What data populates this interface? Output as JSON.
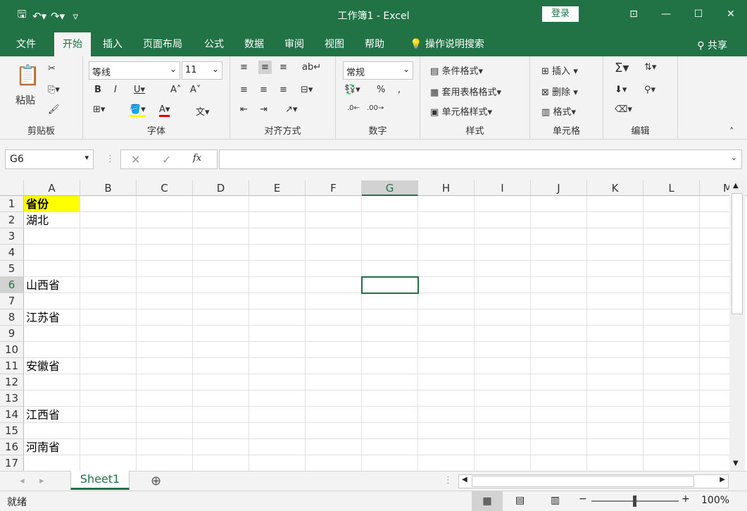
{
  "titlebar": {
    "title": "工作簿1 - Excel",
    "login": "登录",
    "qat": [
      "save-icon",
      "undo-icon",
      "redo-icon",
      "customize-icon"
    ]
  },
  "menu": {
    "tabs": [
      "文件",
      "开始",
      "插入",
      "页面布局",
      "公式",
      "数据",
      "审阅",
      "视图",
      "帮助"
    ],
    "active_tab": "开始",
    "search": "操作说明搜索",
    "share": "共享"
  },
  "ribbon": {
    "clipboard": {
      "label": "剪贴板",
      "paste": "粘贴"
    },
    "font": {
      "label": "字体",
      "font_name": "等线",
      "font_size": "11"
    },
    "align": {
      "label": "对齐方式"
    },
    "number": {
      "label": "数字",
      "format": "常规"
    },
    "styles": {
      "label": "样式",
      "cond": "条件格式",
      "table": "套用表格格式",
      "cell": "单元格样式"
    },
    "cells": {
      "label": "单元格",
      "insert": "插入",
      "delete": "删除",
      "format": "格式"
    },
    "edit": {
      "label": "编辑"
    }
  },
  "formula": {
    "namebox": "G6",
    "fx": "fx",
    "content": ""
  },
  "grid": {
    "columns": [
      "A",
      "B",
      "C",
      "D",
      "E",
      "F",
      "G",
      "H",
      "I",
      "J",
      "K",
      "L",
      "M"
    ],
    "selected_column": "G",
    "rows": [
      "1",
      "2",
      "3",
      "4",
      "5",
      "6",
      "7",
      "8",
      "9",
      "10",
      "11",
      "12",
      "13",
      "14",
      "15",
      "16",
      "17"
    ],
    "selected_row": "6",
    "cellsA": [
      "省份",
      "湖北",
      "",
      "",
      "",
      "山西省",
      "",
      "江苏省",
      "",
      "",
      "安徽省",
      "",
      "",
      "江西省",
      "",
      "河南省",
      ""
    ],
    "header_highlight": "#ffff00"
  },
  "sheets": {
    "tabs": [
      "Sheet1"
    ]
  },
  "status": {
    "text": "就绪",
    "zoom": "100%"
  },
  "colors": {
    "brand": "#217346"
  }
}
